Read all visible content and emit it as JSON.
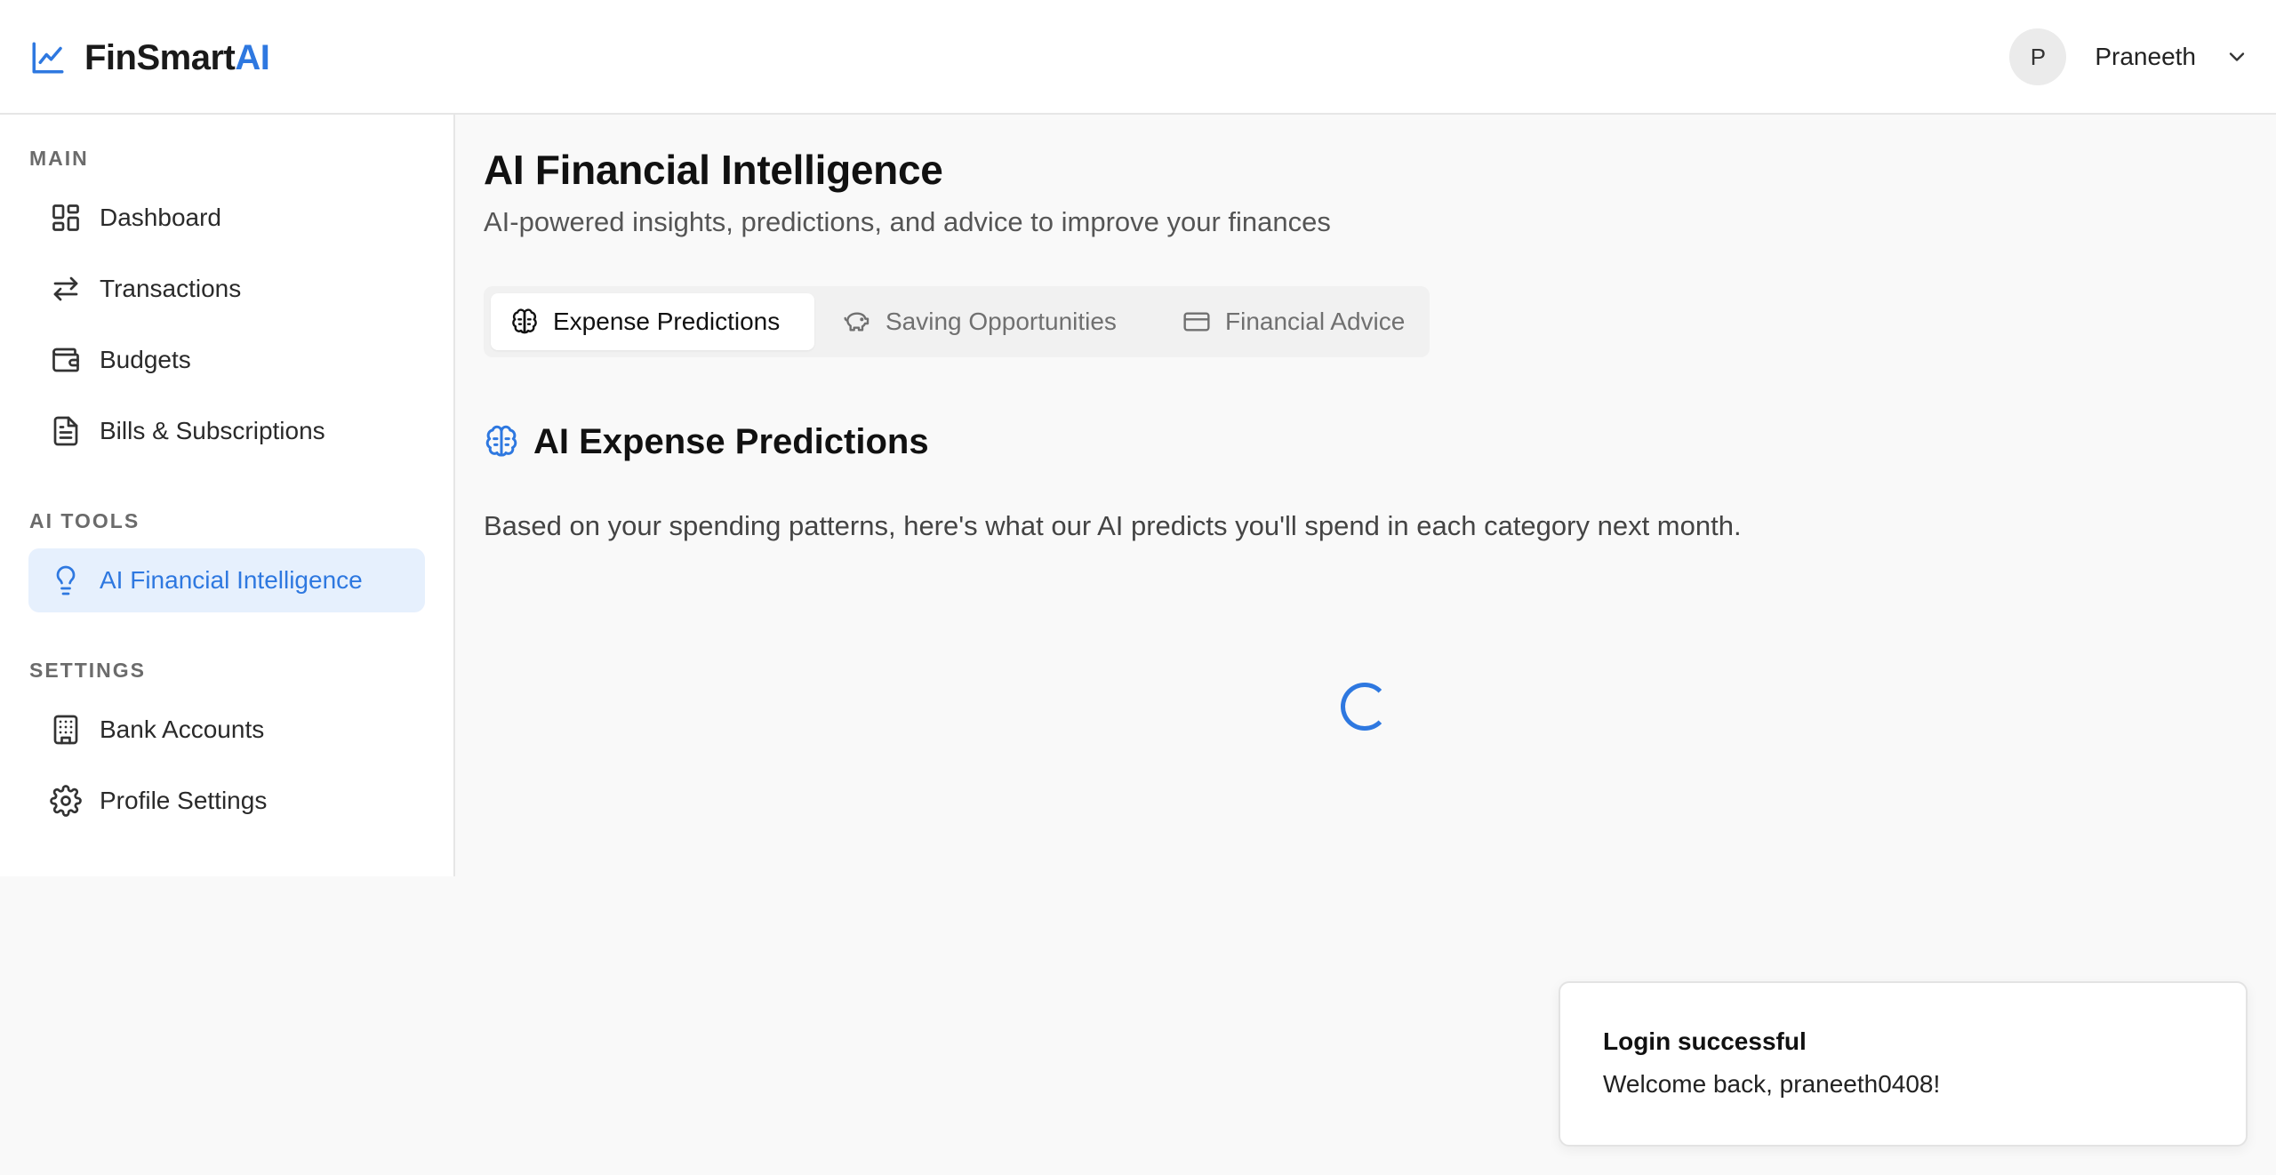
{
  "app": {
    "brand_main": "FinSmart",
    "brand_accent": "AI",
    "brand_icon": "line-chart-icon",
    "accent_color": "#2e78e0"
  },
  "user": {
    "initial": "P",
    "name": "Praneeth"
  },
  "sidebar": {
    "sections": [
      {
        "label": "MAIN"
      },
      {
        "label": "AI TOOLS"
      },
      {
        "label": "SETTINGS"
      }
    ],
    "items": [
      {
        "label": "Dashboard",
        "icon": "dashboard-grid-icon"
      },
      {
        "label": "Transactions",
        "icon": "transfer-arrows-icon"
      },
      {
        "label": "Budgets",
        "icon": "wallet-icon"
      },
      {
        "label": "Bills & Subscriptions",
        "icon": "document-icon"
      },
      {
        "label": "AI Financial Intelligence",
        "icon": "lightbulb-icon",
        "active": true
      },
      {
        "label": "Bank Accounts",
        "icon": "building-icon"
      },
      {
        "label": "Profile Settings",
        "icon": "gear-icon"
      }
    ]
  },
  "main": {
    "title": "AI Financial Intelligence",
    "subtitle": "AI-powered insights, predictions, and advice to improve your finances",
    "tabs": [
      {
        "label": "Expense Predictions",
        "icon": "brain-icon",
        "active": true
      },
      {
        "label": "Saving Opportunities",
        "icon": "piggy-bank-icon"
      },
      {
        "label": "Financial Advice",
        "icon": "credit-card-icon"
      }
    ],
    "section": {
      "title": "AI Expense Predictions",
      "icon": "brain-icon",
      "description": "Based on your spending patterns, here's what our AI predicts you'll spend in each category next month."
    }
  },
  "toast": {
    "title": "Login successful",
    "message": "Welcome back, praneeth0408!"
  }
}
